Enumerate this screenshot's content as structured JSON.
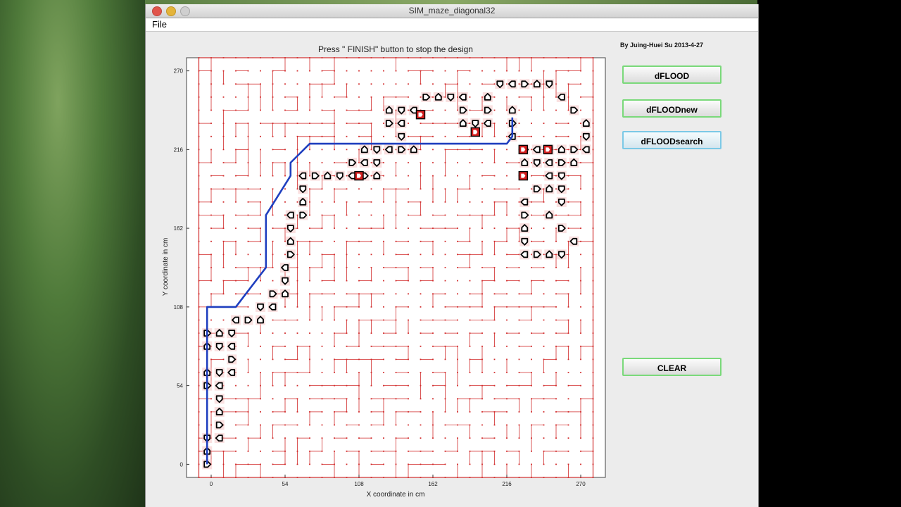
{
  "window": {
    "title": "SIM_maze_diagonal32"
  },
  "menu": {
    "items": [
      "File"
    ]
  },
  "credit": "By Juing-Huei Su 2013-4-27",
  "plot": {
    "title": "Press \" FINISH\" button to stop the design",
    "xlabel": "X coordinate in cm",
    "ylabel": "Y coordinate in cm",
    "x_ticks": [
      "0",
      "54",
      "108",
      "162",
      "216",
      "270"
    ],
    "y_ticks": [
      "0",
      "54",
      "108",
      "162",
      "216",
      "270"
    ],
    "xlim": [
      -18,
      288
    ],
    "ylim": [
      -9,
      279
    ],
    "grid_color": "#d22c2c",
    "path_color": "#1f3fbf"
  },
  "buttons": {
    "dflood": "dFLOOD",
    "dfloodnew": "dFLOODnew",
    "dfloodsearch": "dFLOODsearch",
    "clear": "CLEAR"
  },
  "path": {
    "points": [
      [
        -3,
        0
      ],
      [
        -3,
        108
      ],
      [
        18,
        108
      ],
      [
        40,
        135
      ],
      [
        40,
        171
      ],
      [
        58,
        198
      ],
      [
        58,
        207
      ],
      [
        72,
        220
      ],
      [
        216,
        220
      ],
      [
        220,
        225
      ],
      [
        220,
        238
      ]
    ]
  },
  "cells": {
    "red_cells": [
      [
        108,
        198
      ],
      [
        153,
        240
      ],
      [
        193,
        228
      ],
      [
        228,
        216
      ],
      [
        246,
        216
      ],
      [
        228,
        198
      ]
    ],
    "icon_count_note": ""
  }
}
